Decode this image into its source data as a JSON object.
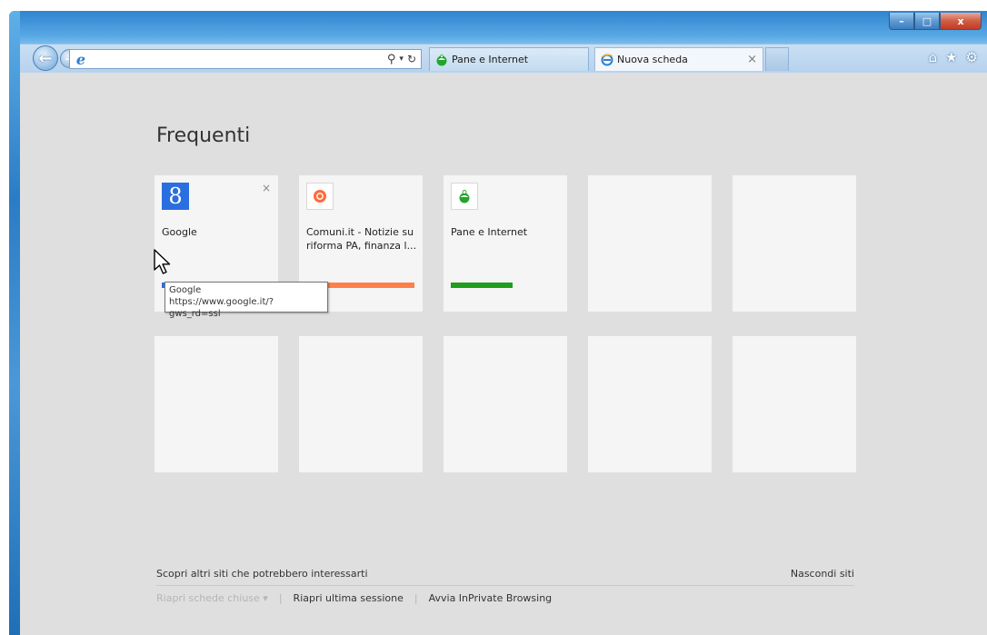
{
  "window": {
    "caption_min": "–",
    "caption_max": "□",
    "caption_close": "x"
  },
  "nav": {
    "back_glyph": "←",
    "forward_glyph": "→"
  },
  "address": {
    "value": "",
    "search_glyph": "⚲",
    "dropdown_glyph": "▾",
    "refresh_glyph": "↻"
  },
  "tabs": [
    {
      "label": "Pane e Internet",
      "icon": "pane-internet-icon"
    },
    {
      "label": "Nuova scheda",
      "icon": "ie-icon",
      "close": "×"
    }
  ],
  "toolbar_icons": {
    "home": "⌂",
    "favorites": "★",
    "tools": "⚙"
  },
  "page": {
    "title": "Frequenti",
    "tiles": [
      {
        "label": "Google",
        "close": "×",
        "icon_letter": "8",
        "bar_color": "#2a6fe0"
      },
      {
        "label": "Comuni.it - Notizie su riforma PA, finanza l...",
        "bar_color": "#ff7f4a"
      },
      {
        "label": "Pane e Internet",
        "bar_color": "#1f9e1f"
      }
    ],
    "tooltip": {
      "line1": "Google",
      "line2": "https://www.google.it/?gws_rd=ssl"
    },
    "discover": "Scopri altri siti che potrebbero interessarti",
    "hide_sites": "Nascondi siti",
    "reopen_closed": "Riapri schede chiuse ▾",
    "reopen_session": "Riapri ultima sessione",
    "inprivate": "Avvia InPrivate Browsing",
    "separator": "|"
  },
  "colors": {
    "content_bg": "#dfdfdf",
    "tile_bg": "#f5f5f5",
    "google_blue": "#2a6fe0",
    "comuni_orange": "#ff7f4a",
    "pane_green": "#1f9e1f"
  }
}
